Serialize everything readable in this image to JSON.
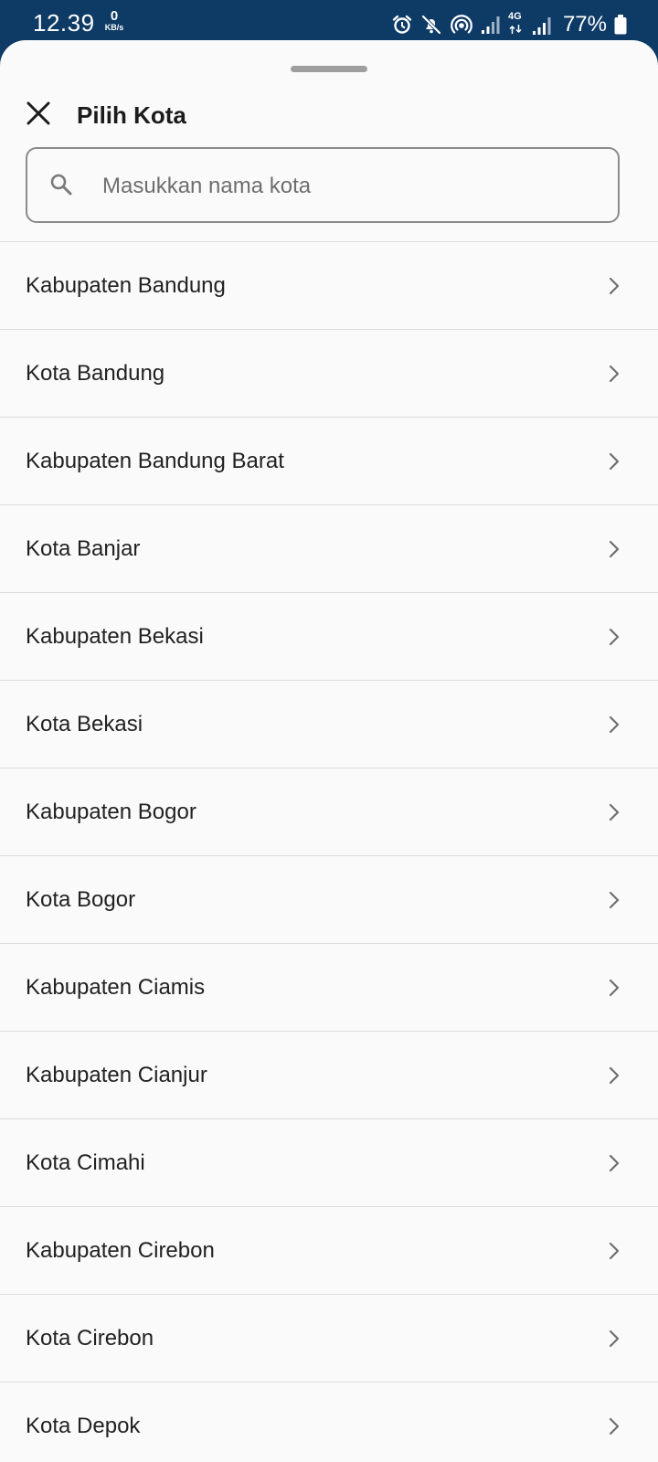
{
  "status_bar": {
    "time": "12.39",
    "net_speed_value": "0",
    "net_speed_unit": "KB/s",
    "network_label": "4G",
    "battery": "77%",
    "icons": [
      "alarm-icon",
      "mute-icon",
      "hotspot-icon",
      "signal-icon",
      "signal-4g-icon",
      "battery-icon"
    ]
  },
  "sheet": {
    "title": "Pilih Kota",
    "close_icon": "close-icon",
    "search": {
      "placeholder": "Masukkan nama kota",
      "value": "",
      "icon": "search-icon"
    }
  },
  "cities": [
    {
      "label": "Kabupaten Bandung"
    },
    {
      "label": "Kota Bandung"
    },
    {
      "label": "Kabupaten Bandung Barat"
    },
    {
      "label": "Kota Banjar"
    },
    {
      "label": "Kabupaten Bekasi"
    },
    {
      "label": "Kota Bekasi"
    },
    {
      "label": "Kabupaten Bogor"
    },
    {
      "label": "Kota Bogor"
    },
    {
      "label": "Kabupaten Ciamis"
    },
    {
      "label": "Kabupaten Cianjur"
    },
    {
      "label": "Kota Cimahi"
    },
    {
      "label": "Kabupaten Cirebon"
    },
    {
      "label": "Kota Cirebon"
    },
    {
      "label": "Kota Depok"
    }
  ],
  "colors": {
    "status_bar": "#0e3a66",
    "sheet_background": "#fafafa",
    "divider": "#dcdcdc",
    "text": "#222222"
  }
}
